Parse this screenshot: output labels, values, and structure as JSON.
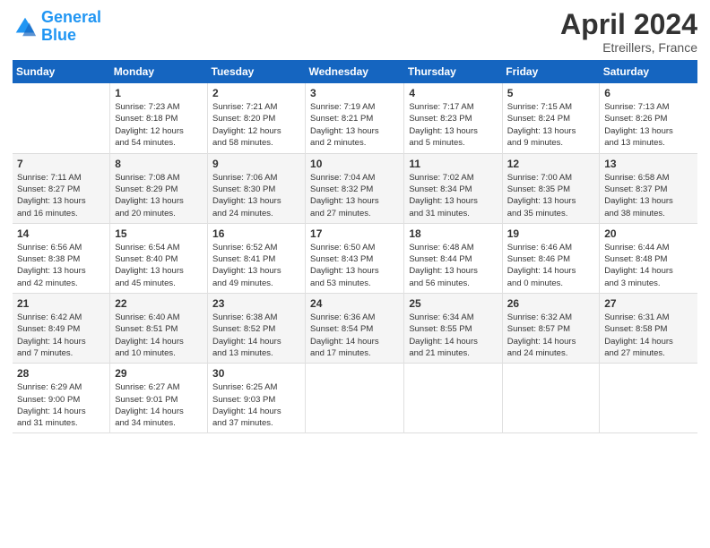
{
  "header": {
    "logo_line1": "General",
    "logo_line2": "Blue",
    "month_title": "April 2024",
    "subtitle": "Etreillers, France"
  },
  "days_of_week": [
    "Sunday",
    "Monday",
    "Tuesday",
    "Wednesday",
    "Thursday",
    "Friday",
    "Saturday"
  ],
  "weeks": [
    [
      {
        "day": "",
        "content": ""
      },
      {
        "day": "1",
        "content": "Sunrise: 7:23 AM\nSunset: 8:18 PM\nDaylight: 12 hours\nand 54 minutes."
      },
      {
        "day": "2",
        "content": "Sunrise: 7:21 AM\nSunset: 8:20 PM\nDaylight: 12 hours\nand 58 minutes."
      },
      {
        "day": "3",
        "content": "Sunrise: 7:19 AM\nSunset: 8:21 PM\nDaylight: 13 hours\nand 2 minutes."
      },
      {
        "day": "4",
        "content": "Sunrise: 7:17 AM\nSunset: 8:23 PM\nDaylight: 13 hours\nand 5 minutes."
      },
      {
        "day": "5",
        "content": "Sunrise: 7:15 AM\nSunset: 8:24 PM\nDaylight: 13 hours\nand 9 minutes."
      },
      {
        "day": "6",
        "content": "Sunrise: 7:13 AM\nSunset: 8:26 PM\nDaylight: 13 hours\nand 13 minutes."
      }
    ],
    [
      {
        "day": "7",
        "content": "Sunrise: 7:11 AM\nSunset: 8:27 PM\nDaylight: 13 hours\nand 16 minutes."
      },
      {
        "day": "8",
        "content": "Sunrise: 7:08 AM\nSunset: 8:29 PM\nDaylight: 13 hours\nand 20 minutes."
      },
      {
        "day": "9",
        "content": "Sunrise: 7:06 AM\nSunset: 8:30 PM\nDaylight: 13 hours\nand 24 minutes."
      },
      {
        "day": "10",
        "content": "Sunrise: 7:04 AM\nSunset: 8:32 PM\nDaylight: 13 hours\nand 27 minutes."
      },
      {
        "day": "11",
        "content": "Sunrise: 7:02 AM\nSunset: 8:34 PM\nDaylight: 13 hours\nand 31 minutes."
      },
      {
        "day": "12",
        "content": "Sunrise: 7:00 AM\nSunset: 8:35 PM\nDaylight: 13 hours\nand 35 minutes."
      },
      {
        "day": "13",
        "content": "Sunrise: 6:58 AM\nSunset: 8:37 PM\nDaylight: 13 hours\nand 38 minutes."
      }
    ],
    [
      {
        "day": "14",
        "content": "Sunrise: 6:56 AM\nSunset: 8:38 PM\nDaylight: 13 hours\nand 42 minutes."
      },
      {
        "day": "15",
        "content": "Sunrise: 6:54 AM\nSunset: 8:40 PM\nDaylight: 13 hours\nand 45 minutes."
      },
      {
        "day": "16",
        "content": "Sunrise: 6:52 AM\nSunset: 8:41 PM\nDaylight: 13 hours\nand 49 minutes."
      },
      {
        "day": "17",
        "content": "Sunrise: 6:50 AM\nSunset: 8:43 PM\nDaylight: 13 hours\nand 53 minutes."
      },
      {
        "day": "18",
        "content": "Sunrise: 6:48 AM\nSunset: 8:44 PM\nDaylight: 13 hours\nand 56 minutes."
      },
      {
        "day": "19",
        "content": "Sunrise: 6:46 AM\nSunset: 8:46 PM\nDaylight: 14 hours\nand 0 minutes."
      },
      {
        "day": "20",
        "content": "Sunrise: 6:44 AM\nSunset: 8:48 PM\nDaylight: 14 hours\nand 3 minutes."
      }
    ],
    [
      {
        "day": "21",
        "content": "Sunrise: 6:42 AM\nSunset: 8:49 PM\nDaylight: 14 hours\nand 7 minutes."
      },
      {
        "day": "22",
        "content": "Sunrise: 6:40 AM\nSunset: 8:51 PM\nDaylight: 14 hours\nand 10 minutes."
      },
      {
        "day": "23",
        "content": "Sunrise: 6:38 AM\nSunset: 8:52 PM\nDaylight: 14 hours\nand 13 minutes."
      },
      {
        "day": "24",
        "content": "Sunrise: 6:36 AM\nSunset: 8:54 PM\nDaylight: 14 hours\nand 17 minutes."
      },
      {
        "day": "25",
        "content": "Sunrise: 6:34 AM\nSunset: 8:55 PM\nDaylight: 14 hours\nand 21 minutes."
      },
      {
        "day": "26",
        "content": "Sunrise: 6:32 AM\nSunset: 8:57 PM\nDaylight: 14 hours\nand 24 minutes."
      },
      {
        "day": "27",
        "content": "Sunrise: 6:31 AM\nSunset: 8:58 PM\nDaylight: 14 hours\nand 27 minutes."
      }
    ],
    [
      {
        "day": "28",
        "content": "Sunrise: 6:29 AM\nSunset: 9:00 PM\nDaylight: 14 hours\nand 31 minutes."
      },
      {
        "day": "29",
        "content": "Sunrise: 6:27 AM\nSunset: 9:01 PM\nDaylight: 14 hours\nand 34 minutes."
      },
      {
        "day": "30",
        "content": "Sunrise: 6:25 AM\nSunset: 9:03 PM\nDaylight: 14 hours\nand 37 minutes."
      },
      {
        "day": "",
        "content": ""
      },
      {
        "day": "",
        "content": ""
      },
      {
        "day": "",
        "content": ""
      },
      {
        "day": "",
        "content": ""
      }
    ]
  ]
}
